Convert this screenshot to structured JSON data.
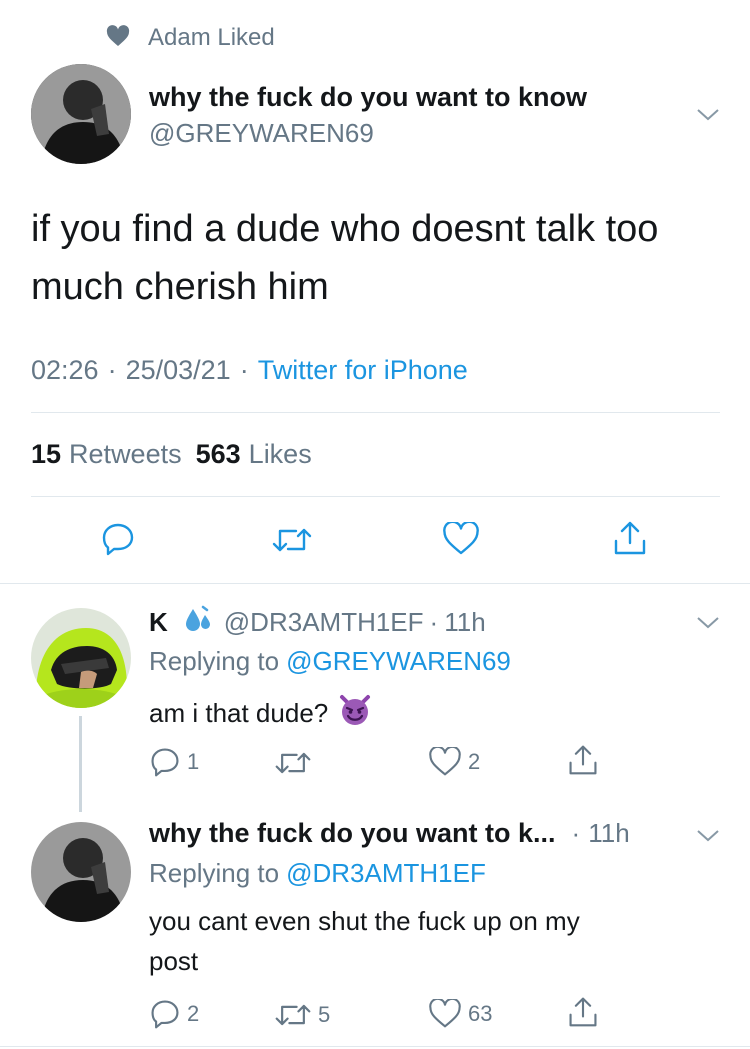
{
  "social_context": {
    "icon": "heart-icon",
    "text": "Adam Liked"
  },
  "main_tweet": {
    "author_name": "why the fuck do you want to know",
    "handle": "@GREYWAREN69",
    "text_line1": "if you find a dude who doesnt talk too",
    "text_line2": "much cherish him",
    "time": "02:26",
    "date": "25/03/21",
    "source": "Twitter for iPhone",
    "retweets_count": "15",
    "retweets_label": "Retweets",
    "likes_count": "563",
    "likes_label": "Likes"
  },
  "reply1": {
    "name": "K",
    "emoji": "sweat-droplets-icon",
    "handle": "@DR3AMTH1EF",
    "time": "11h",
    "replying_prefix": "Replying to",
    "replying_handle": "@GREYWAREN69",
    "text": "am i that dude?",
    "text_emoji": "smiling-imp-icon",
    "reply_count": "1",
    "retweet_count": "",
    "like_count": "2"
  },
  "reply2": {
    "name": "why the fuck do you want to k...",
    "time": "11h",
    "replying_prefix": "Replying to",
    "replying_handle": "@DR3AMTH1EF",
    "text_line1": "you cant even shut the fuck up on my",
    "text_line2": "post",
    "reply_count": "2",
    "retweet_count": "5",
    "like_count": "63"
  },
  "colors": {
    "accent": "#1b95e0",
    "secondary": "#657786",
    "divider": "#e1e8ed",
    "avatar_green": "#b5e61d"
  }
}
